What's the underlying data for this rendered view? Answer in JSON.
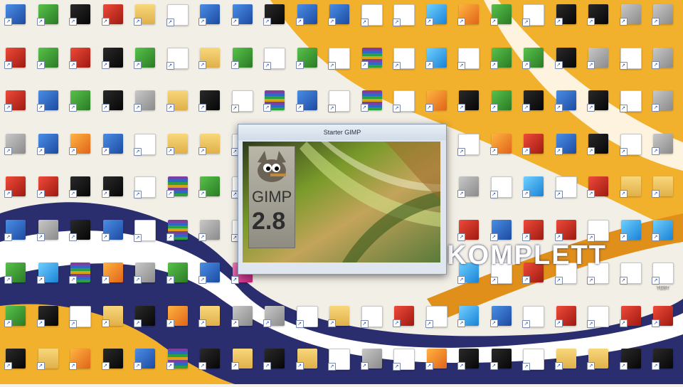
{
  "wallpaper": {
    "brand_text": "KOMPLETT",
    "colors": {
      "yellow": "#f2b12c",
      "navy": "#2a2e6e",
      "white": "#ffffff"
    }
  },
  "splash": {
    "title": "Starter GIMP",
    "logo_text": "GIMP",
    "version": "2.8",
    "progress_fraction": 0.65,
    "status_text": ""
  },
  "desktop_icons": [
    [
      "",
      "",
      "",
      "",
      "",
      "",
      "",
      "",
      "",
      "",
      "",
      "",
      "",
      "",
      "",
      "",
      "",
      "",
      "",
      "",
      ""
    ],
    [
      "",
      "",
      "",
      "",
      "",
      "",
      "",
      "",
      "",
      "",
      "",
      "",
      "",
      "",
      "",
      "",
      "",
      "",
      "",
      "",
      ""
    ],
    [
      "",
      "",
      "",
      "",
      "",
      "",
      "",
      "",
      "",
      "",
      "",
      "",
      "",
      "",
      "",
      "",
      "",
      "",
      "",
      "",
      ""
    ],
    [
      "",
      "",
      "",
      "",
      "",
      "",
      "",
      "",
      "",
      "",
      "",
      "",
      "",
      "",
      "",
      "",
      "",
      "",
      "",
      "",
      ""
    ],
    [
      "",
      "",
      "",
      "",
      "",
      "",
      "",
      "",
      "",
      "",
      "",
      "",
      "",
      "",
      "",
      "",
      "",
      "",
      "",
      "",
      ""
    ],
    [
      "",
      "",
      "",
      "",
      "",
      "",
      "",
      "",
      "",
      "",
      "",
      "",
      "",
      "",
      "",
      "",
      "",
      "",
      "",
      "",
      ""
    ],
    [
      "",
      "",
      "",
      "",
      "",
      "",
      "",
      "",
      "",
      "",
      "",
      "",
      "",
      "",
      "",
      "",
      "",
      "",
      "",
      "",
      "TEST"
    ],
    [
      "",
      "",
      "",
      "",
      "",
      "",
      "",
      "",
      "",
      "",
      "",
      "",
      "",
      "",
      "",
      "",
      "",
      "",
      "",
      "",
      ""
    ],
    [
      "",
      "",
      "",
      "",
      "",
      "",
      "",
      "",
      "",
      "",
      "",
      "",
      "",
      "",
      "",
      "",
      "",
      "",
      "",
      "",
      ""
    ]
  ],
  "icon_kinds": [
    [
      "app",
      "green",
      "dark",
      "red",
      "folder",
      "file",
      "app",
      "app",
      "dark",
      "app",
      "app",
      "file",
      "file",
      "sky",
      "orange",
      "green",
      "file",
      "dark",
      "dark",
      "gray",
      "gray"
    ],
    [
      "red",
      "green",
      "red",
      "dark",
      "green",
      "file",
      "folder",
      "green",
      "file",
      "green",
      "file",
      "archive",
      "file",
      "sky",
      "file",
      "green",
      "green",
      "dark",
      "gray",
      "file",
      "gray"
    ],
    [
      "red",
      "app",
      "green",
      "dark",
      "gray",
      "folder",
      "dark",
      "file",
      "archive",
      "app",
      "file",
      "archive",
      "file",
      "gold",
      "dark",
      "green",
      "dark",
      "app",
      "dark",
      "file",
      "gray"
    ],
    [
      "gray",
      "app",
      "orange",
      "app",
      "file",
      "folder",
      "folder",
      "file",
      "file",
      "file",
      "file",
      "file",
      "file",
      "sky",
      "file",
      "orange",
      "red",
      "app",
      "dark",
      "file",
      "gray"
    ],
    [
      "red",
      "red",
      "dark",
      "dark",
      "file",
      "archive",
      "green",
      "file",
      "file",
      "file",
      "file",
      "file",
      "file",
      "sky",
      "gray",
      "file",
      "sky",
      "file",
      "red",
      "folder",
      "folder"
    ],
    [
      "app",
      "gray",
      "dark",
      "app",
      "file",
      "archive",
      "gray",
      "file",
      "file",
      "file",
      "file",
      "file",
      "file",
      "orange",
      "red",
      "app",
      "red",
      "red",
      "file",
      "sky",
      "sky"
    ],
    [
      "green",
      "sky",
      "archive",
      "gold",
      "gray",
      "green",
      "app",
      "pink",
      "file",
      "file",
      "file",
      "file",
      "file",
      "file",
      "sky",
      "file",
      "red",
      "file",
      "file",
      "file",
      "file"
    ],
    [
      "green",
      "dark",
      "file",
      "folder",
      "dark",
      "gold",
      "folder",
      "gray",
      "gray",
      "file",
      "folder",
      "file",
      "red",
      "file",
      "sky",
      "app",
      "file",
      "red",
      "file",
      "red",
      "red"
    ],
    [
      "dark",
      "folder",
      "orange",
      "dark",
      "app",
      "archive",
      "dark",
      "folder",
      "dark",
      "folder",
      "file",
      "gray",
      "file",
      "orange",
      "dark",
      "dark",
      "file",
      "folder",
      "folder",
      "dark",
      "dark"
    ]
  ],
  "shortcut_glyph": "↗"
}
